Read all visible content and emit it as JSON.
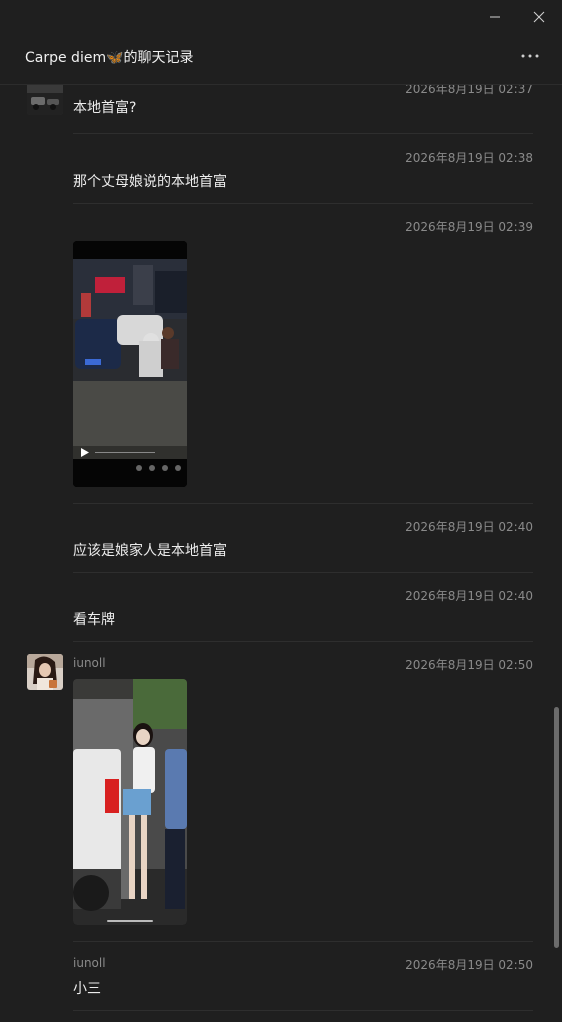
{
  "window": {
    "minimize_glyph": "—",
    "close_glyph": "✕"
  },
  "header": {
    "title": "Carpe diem🦋的聊天记录",
    "more_glyph": "···"
  },
  "messages": [
    {
      "time": "2026年8月19日 02:37",
      "text": "本地首富?"
    },
    {
      "time": "2026年8月19日 02:38",
      "text": "那个丈母娘说的本地首富"
    },
    {
      "time": "2026年8月19日 02:39",
      "type": "video"
    },
    {
      "time": "2026年8月19日 02:40",
      "text": "应该是娘家人是本地首富"
    },
    {
      "time": "2026年8月19日 02:40",
      "text": "看车牌"
    },
    {
      "sender": "iunoll",
      "time": "2026年8月19日 02:50",
      "type": "image"
    },
    {
      "sender": "iunoll",
      "time": "2026年8月19日 02:50",
      "text": "小三"
    }
  ],
  "colors": {
    "background": "#1f1f1f",
    "text": "#ececec",
    "muted": "#8a8a8a",
    "divider": "#2e2e2e",
    "scrollbar": "#6b6b6b"
  }
}
